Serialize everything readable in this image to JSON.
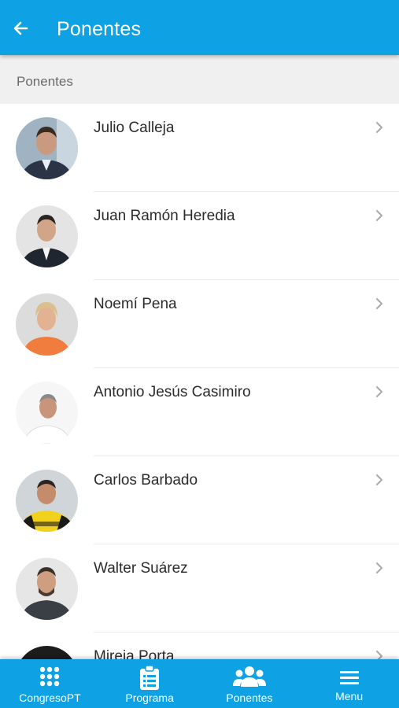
{
  "header": {
    "title": "Ponentes"
  },
  "section": {
    "title": "Ponentes"
  },
  "speakers": [
    {
      "name": "Julio Calleja"
    },
    {
      "name": "Juan Ramón Heredia"
    },
    {
      "name": "Noemí Pena"
    },
    {
      "name": "Antonio Jesús Casimiro"
    },
    {
      "name": "Carlos Barbado"
    },
    {
      "name": "Walter Suárez"
    },
    {
      "name": "Mireia Porta"
    }
  ],
  "nav": {
    "items": [
      {
        "label": "CongresoPT",
        "icon": "grid-icon"
      },
      {
        "label": "Programa",
        "icon": "clipboard-icon"
      },
      {
        "label": "Ponentes",
        "icon": "people-icon"
      },
      {
        "label": "Menu",
        "icon": "hamburger-icon"
      }
    ]
  },
  "colors": {
    "primary": "#0ea1e3",
    "section_bg": "#f0f0f0",
    "text": "#2b2b2b"
  }
}
